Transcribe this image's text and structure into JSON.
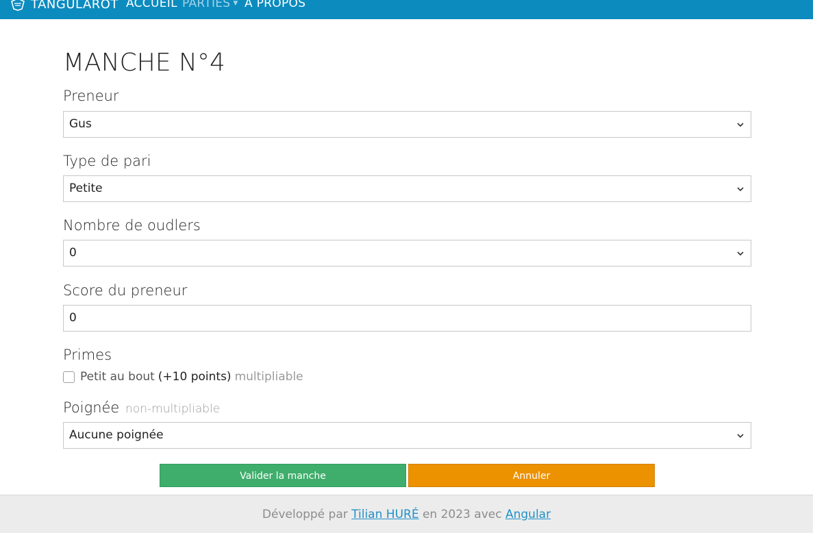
{
  "navbar": {
    "brand": "TANGULAROT",
    "links": [
      {
        "label": "ACCUEIL"
      },
      {
        "label": "PARTIES"
      },
      {
        "label": "À PROPOS"
      }
    ]
  },
  "page": {
    "title": "MANCHE N°4"
  },
  "form": {
    "preneur": {
      "label": "Preneur",
      "value": "Gus"
    },
    "type_pari": {
      "label": "Type de pari",
      "value": "Petite"
    },
    "oudlers": {
      "label": "Nombre de oudlers",
      "value": "0"
    },
    "score": {
      "label": "Score du preneur",
      "value": "0"
    },
    "primes": {
      "label": "Primes",
      "petit_au_bout": {
        "text": "Petit au bout",
        "points": "(+10 points)",
        "note": "multipliable",
        "checked": false
      }
    },
    "poignee": {
      "label": "Poignée",
      "hint": "non-multipliable",
      "value": "Aucune poignée"
    }
  },
  "buttons": {
    "validate": "Valider la manche",
    "cancel": "Annuler"
  },
  "footer": {
    "prefix": "Développé par",
    "author": "Tilian HURÉ",
    "middle": "en 2023 avec",
    "framework": "Angular"
  },
  "colors": {
    "navbar": "#0c8bbf",
    "validate": "#3fad6b",
    "cancel": "#ec9100",
    "link": "#1e90c8"
  }
}
